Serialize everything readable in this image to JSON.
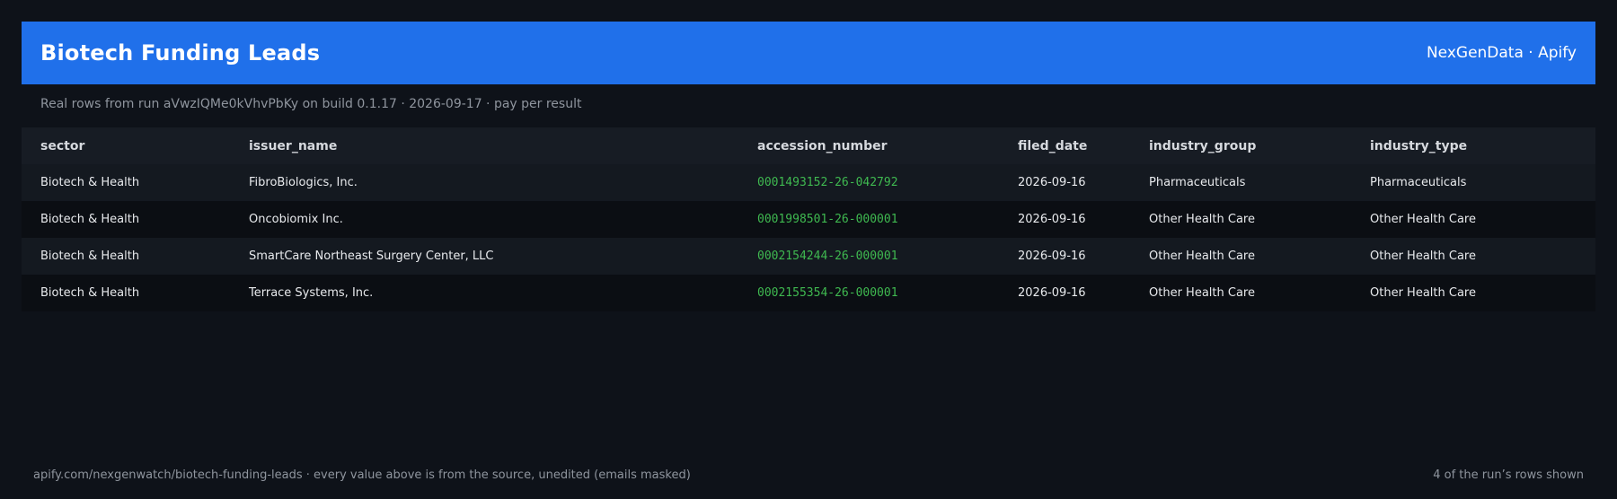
{
  "header": {
    "title": "Biotech Funding Leads",
    "brand": "NexGenData · Apify",
    "accent_color": "#2070ea"
  },
  "subtitle": "Real rows from run aVwzIQMe0kVhvPbKy on build 0.1.17 · 2026-09-17 · pay per result",
  "table": {
    "columns": [
      "sector",
      "issuer_name",
      "accession_number",
      "filed_date",
      "industry_group",
      "industry_type"
    ],
    "rows": [
      [
        "Biotech & Health",
        "FibroBiologics, Inc.",
        "0001493152-26-042792",
        "2026-09-16",
        "Pharmaceuticals",
        "Pharmaceuticals"
      ],
      [
        "Biotech & Health",
        "Oncobiomix Inc.",
        "0001998501-26-000001",
        "2026-09-16",
        "Other Health Care",
        "Other Health Care"
      ],
      [
        "Biotech & Health",
        "SmartCare Northeast Surgery Center, LLC",
        "0002154244-26-000001",
        "2026-09-16",
        "Other Health Care",
        "Other Health Care"
      ],
      [
        "Biotech & Health",
        "Terrace Systems, Inc.",
        "0002155354-26-000001",
        "2026-09-16",
        "Other Health Care",
        "Other Health Care"
      ]
    ],
    "accession_color": "#3fb950"
  },
  "footer": {
    "left": "apify.com/nexgenwatch/biotech-funding-leads  ·  every value above is from the source, unedited (emails masked)",
    "right": "4 of the run’s rows shown"
  }
}
